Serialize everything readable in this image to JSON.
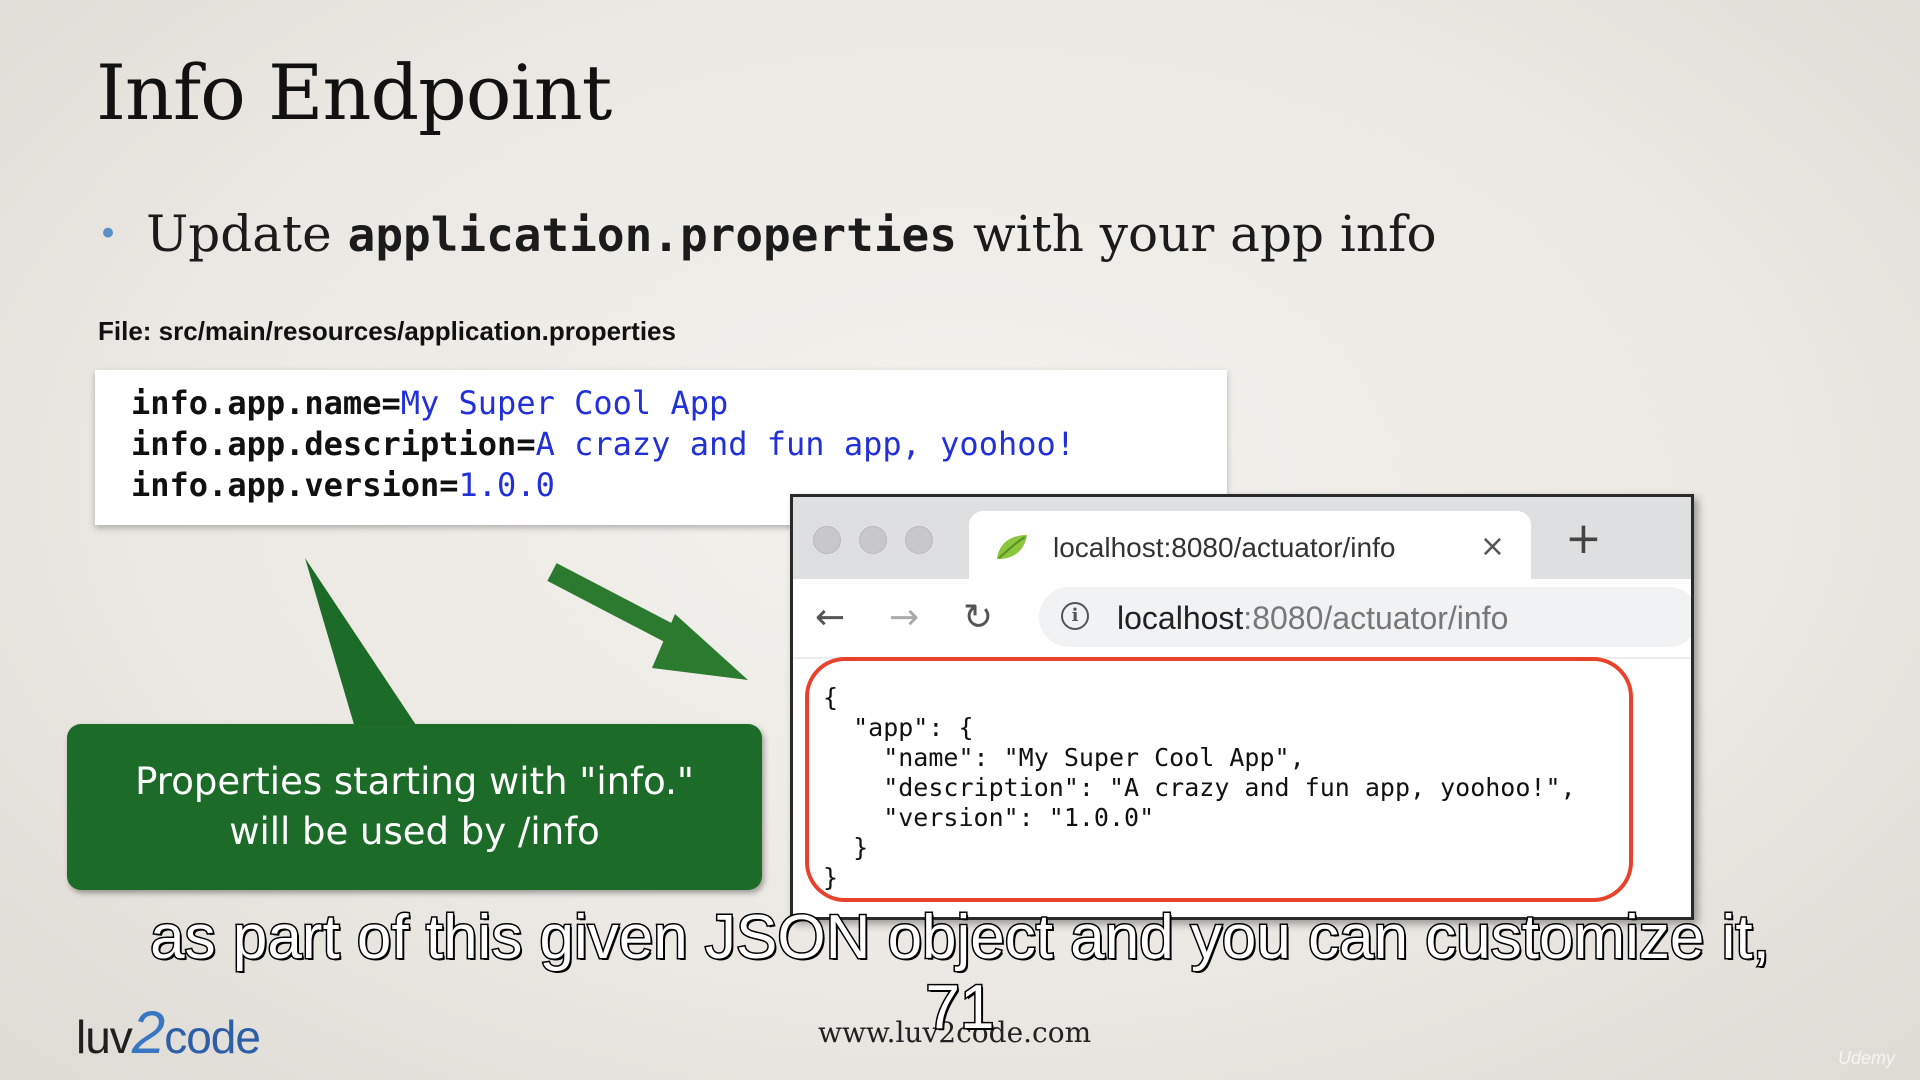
{
  "slide": {
    "title": "Info Endpoint",
    "bullet_prefix": "Update",
    "bullet_code": "application.properties",
    "bullet_suffix": "with your app info",
    "file_label": "File: src/main/resources/application.properties"
  },
  "properties": [
    {
      "key": "info.app.name=",
      "value": "My Super Cool App"
    },
    {
      "key": "info.app.description=",
      "value": "A crazy and fun app, yoohoo!"
    },
    {
      "key": "info.app.version=",
      "value": "1.0.0"
    }
  ],
  "callout": {
    "line1": "Properties starting with \"info.\"",
    "line2": "will be used by /info"
  },
  "browser": {
    "tab_title": "localhost:8080/actuator/info",
    "tab_close": "×",
    "new_tab": "+",
    "back_icon": "←",
    "forward_icon": "→",
    "reload_icon": "↻",
    "info_icon": "i",
    "url_host": "localhost",
    "url_rest": ":8080/actuator/info",
    "json": "{\n  \"app\": {\n    \"name\": \"My Super Cool App\",\n    \"description\": \"A crazy and fun app, yoohoo!\",\n    \"version\": \"1.0.0\"\n  }\n}"
  },
  "subtitles": {
    "line1": "as part of this given JSON object and you can customize it,",
    "line2": "71"
  },
  "footer": {
    "logo_left": "luv",
    "logo_mid": "2",
    "logo_right": "code",
    "url": "www.luv2code.com",
    "watermark": "Udemy"
  },
  "colors": {
    "callout_green": "#1d6b28",
    "code_value_blue": "#2130d8",
    "highlight_red": "#e8422c"
  }
}
